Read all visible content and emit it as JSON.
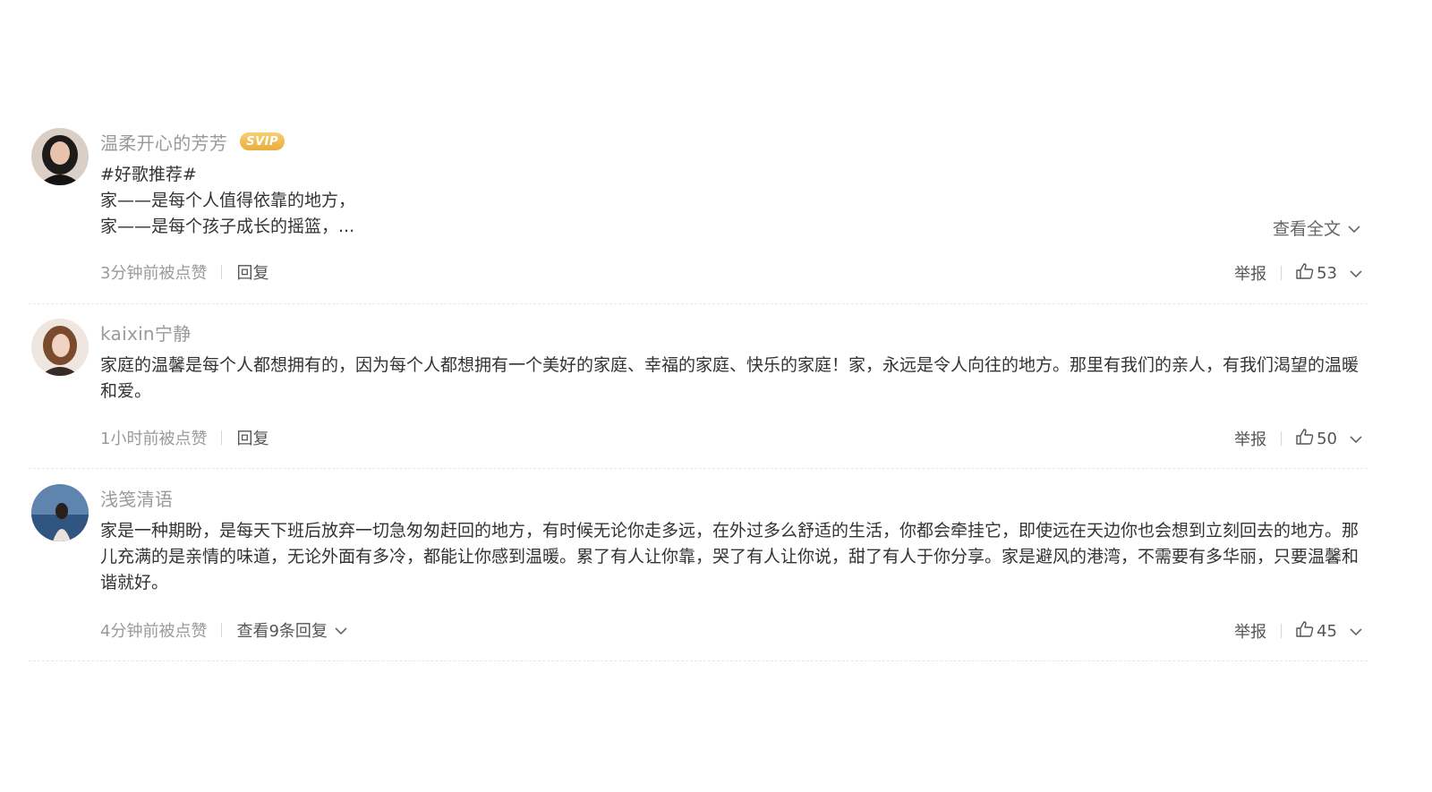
{
  "comments": [
    {
      "username": "温柔开心的芳芳",
      "badge": "SVIP",
      "lines": [
        "#好歌推荐#",
        "家——是每个人值得依靠的地方，",
        "家——是每个孩子成长的摇篮，..."
      ],
      "view_full": "查看全文",
      "time": "3分钟前被点赞",
      "reply": "回复",
      "report": "举报",
      "likes": "53"
    },
    {
      "username": "kaixin宁静",
      "text": "家庭的温馨是每个人都想拥有的，因为每个人都想拥有一个美好的家庭、幸福的家庭、快乐的家庭！家，永远是令人向往的地方。那里有我们的亲人，有我们渴望的温暖和爱。",
      "time": "1小时前被点赞",
      "reply": "回复",
      "report": "举报",
      "likes": "50"
    },
    {
      "username": "浅笺清语",
      "text": "家是一种期盼，是每天下班后放弃一切急匆匆赶回的地方，有时候无论你走多远，在外过多么舒适的生活，你都会牵挂它，即使远在天边你也会想到立刻回去的地方。那儿充满的是亲情的味道，无论外面有多冷，都能让你感到温暖。累了有人让你靠，哭了有人让你说，甜了有人于你分享。家是避风的港湾，不需要有多华丽，只要温馨和谐就好。",
      "time": "4分钟前被点赞",
      "reply": "查看9条回复",
      "report": "举报",
      "likes": "45"
    }
  ],
  "colors": {
    "svip": "#e9ad3c",
    "username": "#9a9a9a",
    "text": "#333333"
  },
  "icons": [
    "chevron-down-icon",
    "thumbs-up-icon"
  ]
}
